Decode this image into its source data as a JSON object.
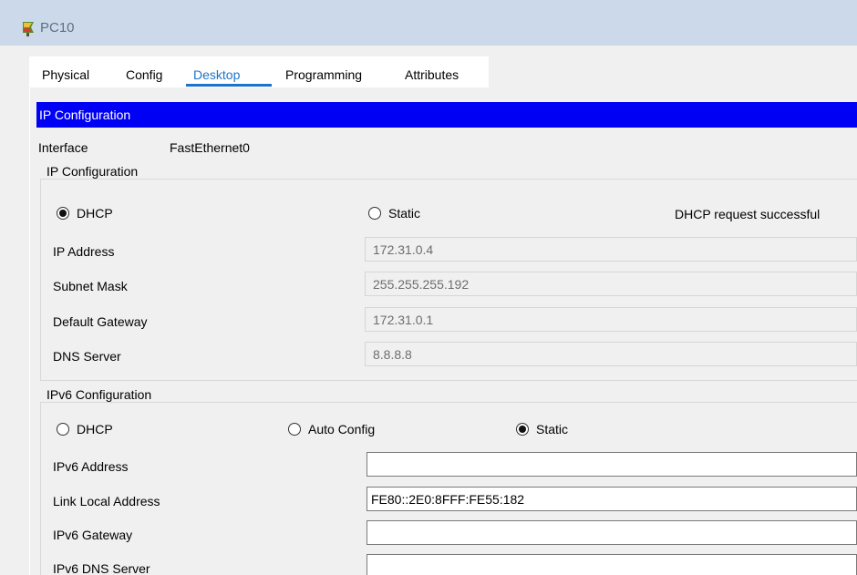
{
  "window": {
    "title": "PC10",
    "icon": "packet-tracer-pc-icon"
  },
  "tabs": [
    {
      "label": "Physical",
      "active": false
    },
    {
      "label": "Config",
      "active": false
    },
    {
      "label": "Desktop",
      "active": true
    },
    {
      "label": "Programming",
      "active": false
    },
    {
      "label": "Attributes",
      "active": false
    }
  ],
  "ip_config": {
    "header": "IP Configuration",
    "interface_label": "Interface",
    "interface_value": "FastEthernet0",
    "group_title": "IP Configuration",
    "dhcp_label": "DHCP",
    "static_label": "Static",
    "mode": "DHCP",
    "status": "DHCP request successful",
    "fields": {
      "ip_address": {
        "label": "IP Address",
        "value": "172.31.0.4"
      },
      "subnet_mask": {
        "label": "Subnet Mask",
        "value": "255.255.255.192"
      },
      "default_gateway": {
        "label": "Default Gateway",
        "value": "172.31.0.1"
      },
      "dns_server": {
        "label": "DNS Server",
        "value": "8.8.8.8"
      }
    }
  },
  "ipv6_config": {
    "group_title": "IPv6 Configuration",
    "dhcp_label": "DHCP",
    "auto_label": "Auto Config",
    "static_label": "Static",
    "mode": "Static",
    "fields": {
      "ipv6_address": {
        "label": "IPv6 Address",
        "value": ""
      },
      "link_local": {
        "label": "Link Local Address",
        "value": "FE80::2E0:8FFF:FE55:182"
      },
      "ipv6_gateway": {
        "label": "IPv6 Gateway",
        "value": ""
      },
      "ipv6_dns": {
        "label": "IPv6 DNS Server",
        "value": ""
      }
    }
  },
  "colors": {
    "accent": "#1e73c8",
    "header_blue": "#0000f5",
    "titlebar": "#ccd9ea"
  }
}
